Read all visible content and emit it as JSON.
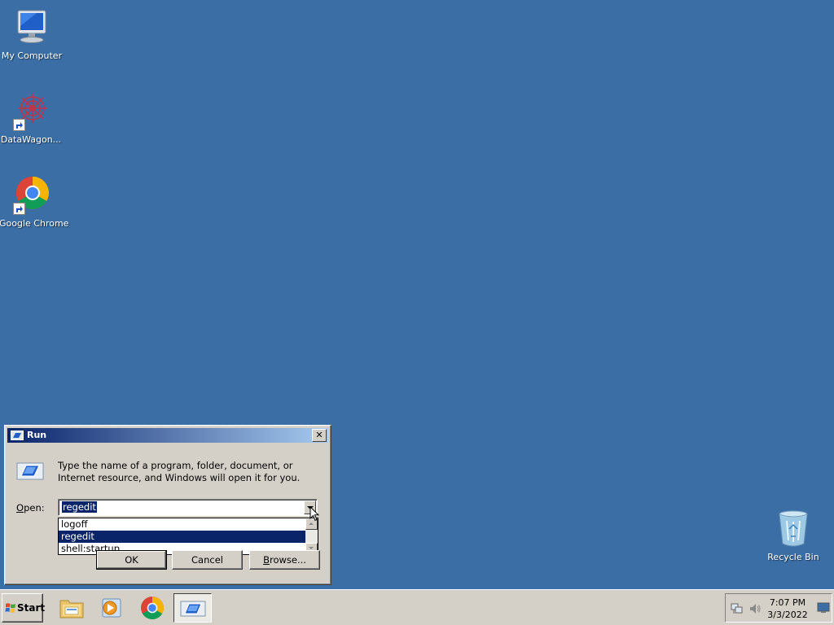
{
  "desktop": {
    "icons": [
      {
        "label": "My Computer"
      },
      {
        "label": "DataWagon..."
      },
      {
        "label": "Google Chrome"
      },
      {
        "label": "Recycle Bin"
      }
    ]
  },
  "run_dialog": {
    "title": "Run",
    "close_symbol": "✕",
    "description": "Type the name of a program, folder, document, or Internet resource, and Windows will open it for you.",
    "open_label_underlined": "O",
    "open_label_rest": "pen:",
    "open_value": "regedit",
    "history": [
      "logoff",
      "regedit",
      "shell:startup"
    ],
    "selected_history_index": 1,
    "buttons": {
      "ok": "OK",
      "cancel": "Cancel",
      "browse_underlined": "B",
      "browse_rest": "rowse..."
    }
  },
  "taskbar": {
    "start_label": "Start",
    "apps": [
      "file-explorer-icon",
      "media-player-icon",
      "chrome-icon",
      "run-icon"
    ],
    "clock": {
      "time": "7:07 PM",
      "date": "3/3/2022"
    }
  },
  "colors": {
    "desktop": "#3a6ea5",
    "titlebar_start": "#0a246a",
    "titlebar_end": "#a6caf0",
    "selection": "#0a246a"
  }
}
